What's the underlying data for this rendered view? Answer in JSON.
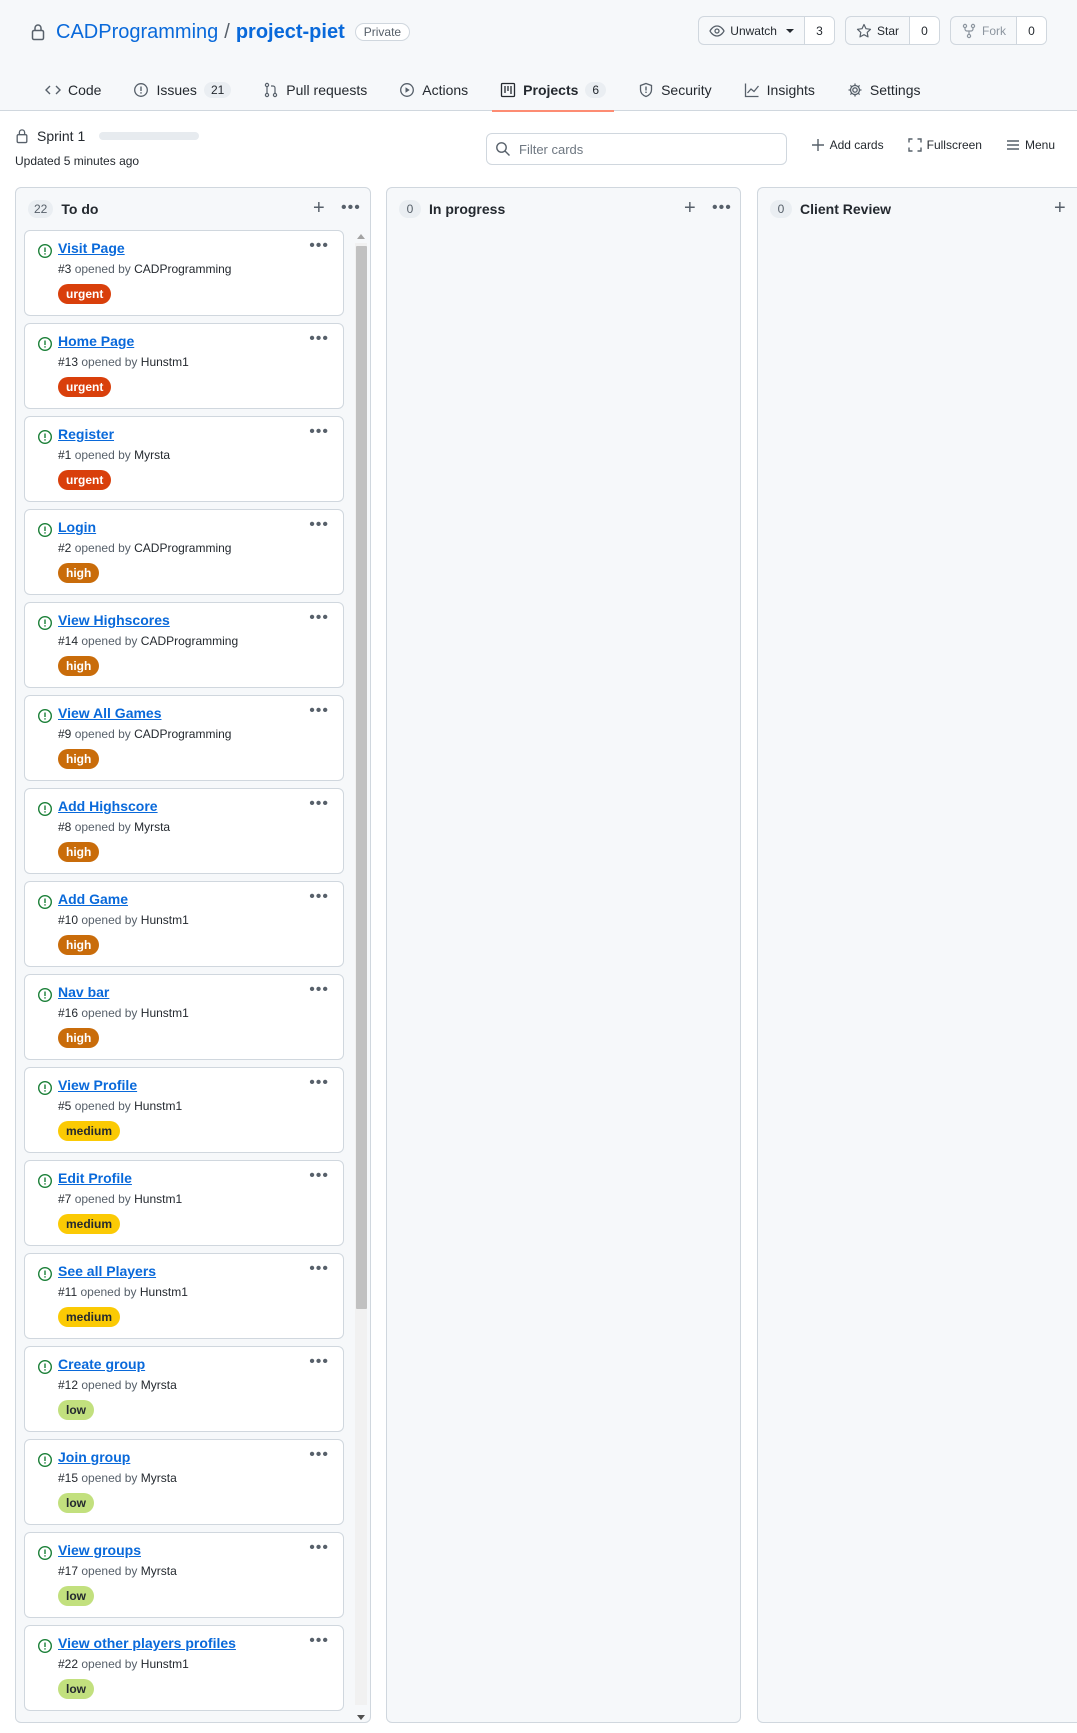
{
  "repo": {
    "owner": "CADProgramming",
    "separator": "/",
    "name": "project-piet",
    "visibility": "Private"
  },
  "watch": {
    "label": "Unwatch",
    "count": "3"
  },
  "star": {
    "label": "Star",
    "count": "0"
  },
  "fork": {
    "label": "Fork",
    "count": "0"
  },
  "tabs": [
    {
      "label": "Code",
      "icon": "code-icon"
    },
    {
      "label": "Issues",
      "count": "21",
      "icon": "issue-icon"
    },
    {
      "label": "Pull requests",
      "icon": "pull-request-icon"
    },
    {
      "label": "Actions",
      "icon": "play-icon"
    },
    {
      "label": "Projects",
      "count": "6",
      "icon": "project-icon",
      "active": true
    },
    {
      "label": "Security",
      "icon": "shield-icon"
    },
    {
      "label": "Insights",
      "icon": "graph-icon"
    },
    {
      "label": "Settings",
      "icon": "gear-icon"
    }
  ],
  "project": {
    "name": "Sprint 1",
    "updated": "Updated 5 minutes ago",
    "filter_placeholder": "Filter cards",
    "add_cards": "Add cards",
    "fullscreen": "Fullscreen",
    "menu": "Menu"
  },
  "colors": {
    "urgent": "#d93f0b",
    "high": "#c96c0a",
    "medium": "#fbca04",
    "low": "#c2e07e",
    "open_issue": "#1a7f37",
    "link": "#0969da"
  },
  "columns": [
    {
      "count": "22",
      "title": "To do"
    },
    {
      "count": "0",
      "title": "In progress"
    },
    {
      "count": "0",
      "title": "Client Review"
    }
  ],
  "cards": [
    {
      "title": "Visit Page",
      "number": "#3",
      "opened_by": "opened by",
      "author": "CADProgramming",
      "label": "urgent"
    },
    {
      "title": "Home Page",
      "number": "#13",
      "opened_by": "opened by",
      "author": "Hunstm1",
      "label": "urgent"
    },
    {
      "title": "Register",
      "number": "#1",
      "opened_by": "opened by",
      "author": "Myrsta",
      "label": "urgent"
    },
    {
      "title": "Login",
      "number": "#2",
      "opened_by": "opened by",
      "author": "CADProgramming",
      "label": "high"
    },
    {
      "title": "View Highscores",
      "number": "#14",
      "opened_by": "opened by",
      "author": "CADProgramming",
      "label": "high"
    },
    {
      "title": "View All Games",
      "number": "#9",
      "opened_by": "opened by",
      "author": "CADProgramming",
      "label": "high"
    },
    {
      "title": "Add Highscore",
      "number": "#8",
      "opened_by": "opened by",
      "author": "Myrsta",
      "label": "high"
    },
    {
      "title": "Add Game",
      "number": "#10",
      "opened_by": "opened by",
      "author": "Hunstm1",
      "label": "high"
    },
    {
      "title": "Nav bar",
      "number": "#16",
      "opened_by": "opened by",
      "author": "Hunstm1",
      "label": "high"
    },
    {
      "title": "View Profile",
      "number": "#5",
      "opened_by": "opened by",
      "author": "Hunstm1",
      "label": "medium"
    },
    {
      "title": "Edit Profile",
      "number": "#7",
      "opened_by": "opened by",
      "author": "Hunstm1",
      "label": "medium"
    },
    {
      "title": "See all Players",
      "number": "#11",
      "opened_by": "opened by",
      "author": "Hunstm1",
      "label": "medium"
    },
    {
      "title": "Create group",
      "number": "#12",
      "opened_by": "opened by",
      "author": "Myrsta",
      "label": "low"
    },
    {
      "title": "Join group",
      "number": "#15",
      "opened_by": "opened by",
      "author": "Myrsta",
      "label": "low"
    },
    {
      "title": "View groups",
      "number": "#17",
      "opened_by": "opened by",
      "author": "Myrsta",
      "label": "low"
    },
    {
      "title": "View other players profiles",
      "number": "#22",
      "opened_by": "opened by",
      "author": "Hunstm1",
      "label": "low"
    }
  ]
}
